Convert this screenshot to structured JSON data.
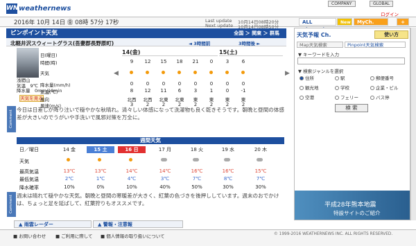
{
  "header": {
    "logo": "WN",
    "brand": "weathernews",
    "company": "COMPANY",
    "global": "GLOBAL",
    "login": "ログイン"
  },
  "dateline": {
    "date": "2016年 10月 14日 ㊎ 08時 57分 17秒",
    "last_update_label": "Last update",
    "last_update": "10月14日08時20分",
    "next_update_label": "Next update",
    "next_update": "10月14日08時50分"
  },
  "tabs": {
    "all_channel": "ALL Channel",
    "new": "New",
    "mych": "MyCh.",
    "add": "+"
  },
  "pinpoint": {
    "title": "ピンポイント天気",
    "crumbs": "全国 ＞ 関東 ＞ 群馬",
    "location": "北軽井沢スウィートグラス(吾妻郡長野原町)",
    "prev3": "◄ 3時間前",
    "next3": "3時間後 ►"
  },
  "side_labels": {
    "day": "日(曜日)",
    "time": "時間(時)",
    "weather": "天気",
    "precip": "降水量(mm/h)",
    "temp": "気温(℃)",
    "wind_dir": "風向",
    "wind_speed": "風速(m/s)"
  },
  "station": {
    "name": "浅間山",
    "temp_label": "気温",
    "temp": "9℃",
    "rain_label": "降水量",
    "rain": "0mm/10min",
    "weather_button": "天気を見る"
  },
  "hourly": {
    "day1": "14(金)",
    "day2": "15(土)",
    "times": [
      "9",
      "12",
      "15",
      "18",
      "21",
      "0",
      "3",
      "6"
    ],
    "precip": [
      "0",
      "0",
      "0",
      "0",
      "0",
      "0",
      "0",
      "0"
    ],
    "temp": [
      "8",
      "12",
      "11",
      "6",
      "3",
      "1",
      "0",
      "-1"
    ],
    "wind_dir": [
      "北西",
      "北西",
      "北東",
      "北東",
      "東",
      "東",
      "東",
      "東"
    ],
    "wind_speed": [
      "3",
      "2",
      "2",
      "2",
      "2",
      "2",
      "2",
      "2"
    ]
  },
  "comment1": "今日は日差しが降り注いで穏やかな秋晴れ。清々しい体感になって洗濯物も良く乾きそうです。朝晩と昼間の体感差が大きいのでうがいや手洗いで風邪対策を万全に。",
  "comment_tab": "Comment",
  "weekly": {
    "title": "週間天気",
    "labels": {
      "day": "日／曜日",
      "weather": "天気",
      "max": "最高気温",
      "min": "最低気温",
      "pop": "降水確率"
    },
    "days": [
      "14 金",
      "15 土",
      "16 日",
      "17 月",
      "18 火",
      "19 水",
      "20 木"
    ],
    "max": [
      "13℃",
      "13℃",
      "14℃",
      "14℃",
      "16℃",
      "16℃",
      "15℃"
    ],
    "min": [
      "2℃",
      "1℃",
      "4℃",
      "3℃",
      "7℃",
      "8℃",
      "7℃"
    ],
    "pop": [
      "10%",
      "0%",
      "10%",
      "40%",
      "50%",
      "30%",
      "30%"
    ],
    "day_colors": [
      "#ffffff",
      "#4a7fd6",
      "#e23030",
      "#ffffff",
      "#ffffff",
      "#ffffff",
      "#ffffff"
    ]
  },
  "comment2": "週末は晴れて穏やかな天気。朝晩と昼間の寒暖差が大きく、紅葉の色づきを後押ししています。週末のおでかけは、ちょっと足を延ばして、紅葉狩りもオススメです。",
  "bottom_tabs": {
    "rain_radar": "雨雲レーダー",
    "warnings": "警報・注意報"
  },
  "footer": {
    "contact": "お問い合わせ",
    "terms": "ご利用に際して",
    "privacy": "個人情報の取り扱いについて",
    "copyright": "© 1999-2016 WEATHERNEWS INC. ALL RIGHTS RESERVED."
  },
  "right": {
    "title": "天気予報 Ch.",
    "howto": "使い方",
    "tab_map": "Map天気検索",
    "tab_pinpoint": "Pinpoint天気検索",
    "kw_label": "▼ キーワードを入力",
    "kw_placeholder": "",
    "genre_label": "▼ 検索ジャンルを選択",
    "genres": [
      "住所",
      "駅",
      "郵便番号",
      "観光地",
      "学校",
      "企業・ビル",
      "空港",
      "フェリー",
      "バス停"
    ],
    "search": "検 索",
    "quake_title": "平成28年熊本地震",
    "quake_sub": "特設サイトのご紹介"
  }
}
